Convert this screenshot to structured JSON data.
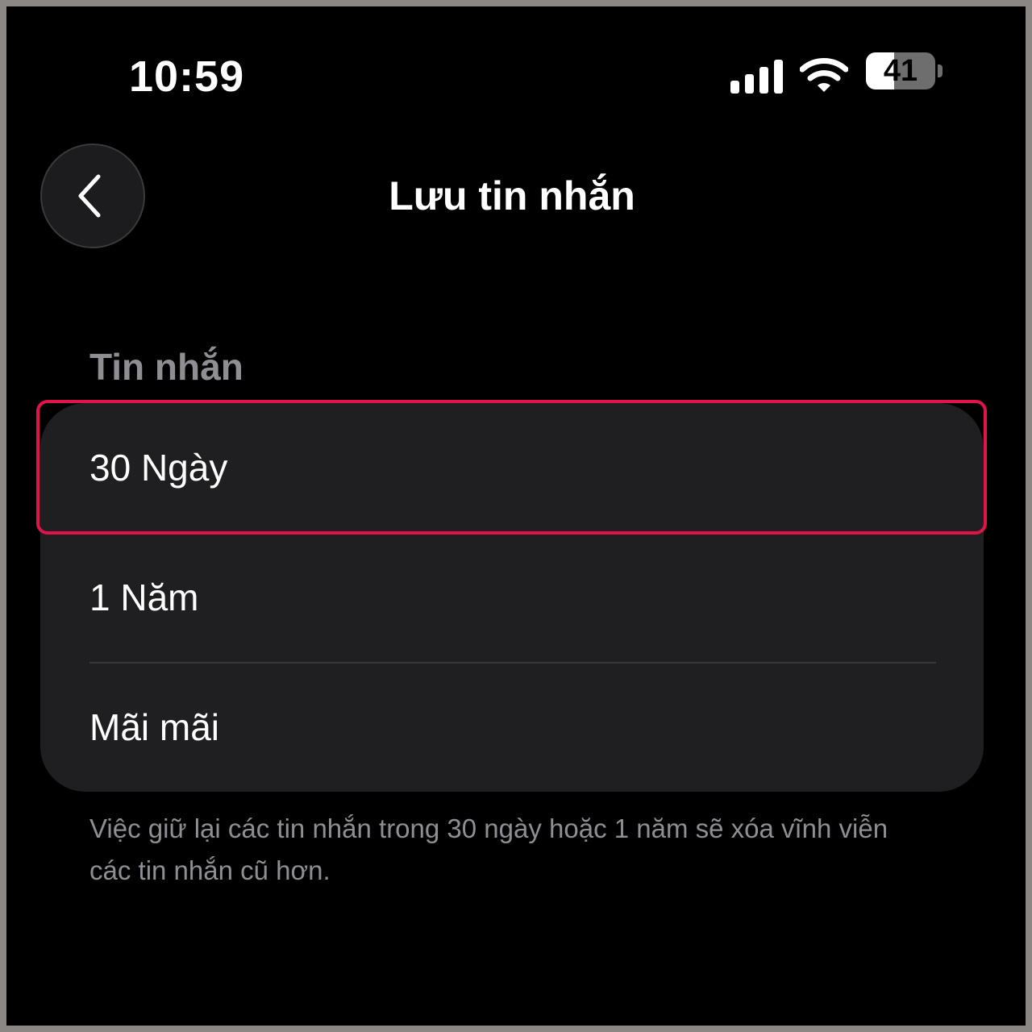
{
  "status_bar": {
    "time": "10:59",
    "battery_level": "41",
    "battery_fraction": 0.41,
    "icons": [
      "signal-icon",
      "wifi-icon",
      "battery-icon"
    ]
  },
  "header": {
    "back_icon": "chevron-left-icon",
    "title": "Lưu tin nhắn"
  },
  "section": {
    "label": "Tin nhắn",
    "options": [
      "30 Ngày",
      "1 Năm",
      "Mãi mãi"
    ],
    "highlighted_option": "30 Ngày"
  },
  "footnote": "Việc giữ lại các tin nhắn trong 30 ngày hoặc 1 năm sẽ xóa vĩnh viễn các tin nhắn cũ hơn.",
  "colors": {
    "background": "#000000",
    "card": "#1f1f21",
    "highlight": "#e0144a",
    "secondary_text": "#8e8e93"
  }
}
